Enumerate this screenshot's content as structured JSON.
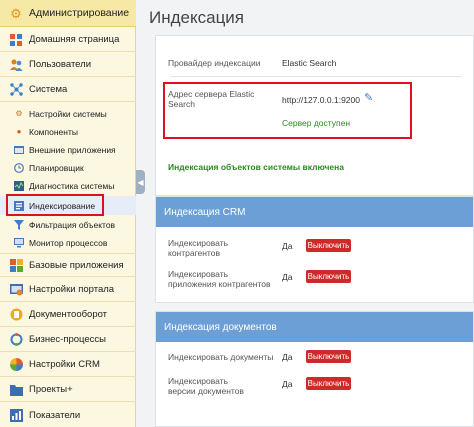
{
  "sidebar": {
    "admin": {
      "label": "Администрирование",
      "icon": "gear-icon",
      "color": "#f0a02a"
    },
    "home": {
      "label": "Домашняя страница",
      "icon": "grid-icon"
    },
    "users": {
      "label": "Пользователи",
      "icon": "users-icon"
    },
    "system": {
      "label": "Система",
      "icon": "system-icon"
    },
    "system_items": [
      {
        "label": "Настройки системы",
        "icon": "settings-icon"
      },
      {
        "label": "Компоненты",
        "icon": "components-icon"
      },
      {
        "label": "Внешние приложения",
        "icon": "external-apps-icon"
      },
      {
        "label": "Планировщик",
        "icon": "scheduler-icon"
      },
      {
        "label": "Диагностика системы",
        "icon": "diagnostics-icon"
      },
      {
        "label": "Индексирование",
        "icon": "indexing-icon"
      },
      {
        "label": "Фильтрация объектов",
        "icon": "filter-icon"
      },
      {
        "label": "Монитор процессов",
        "icon": "monitor-icon"
      }
    ],
    "bottom_items": [
      {
        "label": "Базовые приложения",
        "icon": "apps-icon"
      },
      {
        "label": "Настройки портала",
        "icon": "portal-settings-icon"
      },
      {
        "label": "Документооборот",
        "icon": "documents-icon"
      },
      {
        "label": "Бизнес-процессы",
        "icon": "business-process-icon"
      },
      {
        "label": "Настройки CRM",
        "icon": "crm-icon"
      },
      {
        "label": "Проекты+",
        "icon": "projects-icon"
      },
      {
        "label": "Показатели",
        "icon": "indicators-icon"
      }
    ]
  },
  "main": {
    "title": "Индексация",
    "settings": {
      "provider_label": "Провайдер индексации",
      "provider_value": "Elastic Search",
      "server_label": "Адрес сервера Elastic Search",
      "server_value": "http://127.0.0.1:9200",
      "server_status": "Сервер доступен",
      "system_indexing_status": "Индексация объектов системы включена"
    },
    "crm": {
      "header": "Индексация CRM",
      "rows": [
        {
          "label": "Индексировать контрагентов",
          "value": "Да",
          "button": "Выключить"
        },
        {
          "label": "Индексировать приложения контрагентов",
          "value": "Да",
          "button": "Выключить"
        }
      ]
    },
    "docs": {
      "header": "Индексация документов",
      "rows": [
        {
          "label": "Индексировать документы",
          "value": "Да",
          "button": "Выключить"
        },
        {
          "label": "Индексировать версии документов",
          "value": "Да",
          "button": "Выключить"
        }
      ]
    }
  },
  "colors": {
    "accent_blue": "#6b9fd6",
    "success_green": "#2a8a1d",
    "danger_red": "#cf2a2a",
    "highlight_red": "#d9141e"
  }
}
